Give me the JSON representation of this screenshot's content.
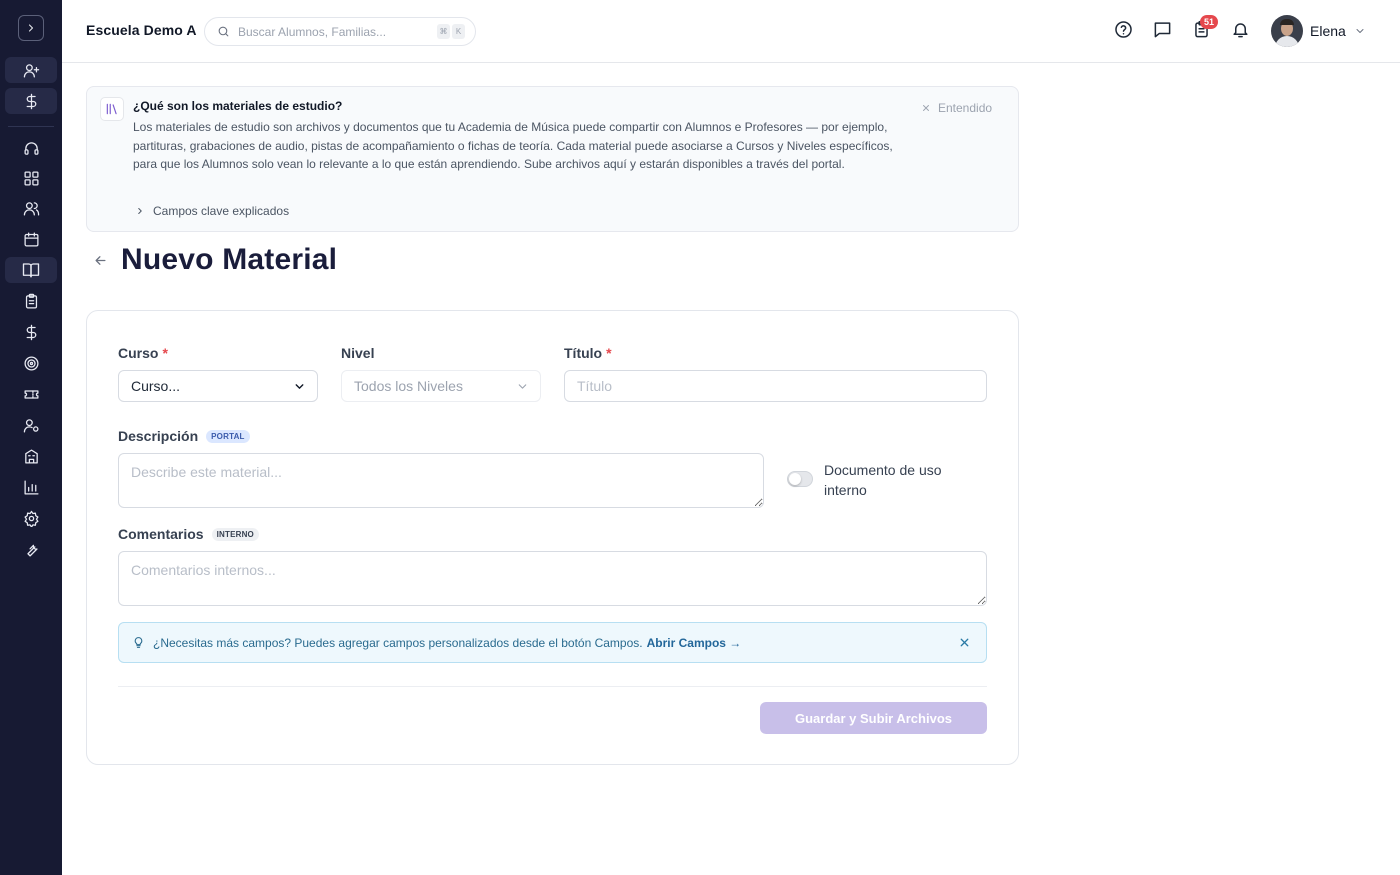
{
  "header": {
    "school_name": "Escuela Demo A",
    "search_placeholder": "Buscar Alumnos, Familias...",
    "shortcut_keys": [
      "⌘",
      "K"
    ],
    "notification_count": "51",
    "user_name": "Elena"
  },
  "sidebar": {
    "items": [
      {
        "icon": "user-plus-icon"
      },
      {
        "icon": "dollar-icon"
      },
      {
        "icon": "headset-icon"
      },
      {
        "icon": "dashboard-icon"
      },
      {
        "icon": "users-icon"
      },
      {
        "icon": "calendar-icon"
      },
      {
        "icon": "book-open-icon",
        "active": true
      },
      {
        "icon": "clipboard-icon"
      },
      {
        "icon": "dollar-icon"
      },
      {
        "icon": "target-icon"
      },
      {
        "icon": "ticket-icon"
      },
      {
        "icon": "user-cog-icon"
      },
      {
        "icon": "building-icon"
      },
      {
        "icon": "bar-chart-icon"
      },
      {
        "icon": "settings-icon"
      },
      {
        "icon": "wrench-icon"
      }
    ]
  },
  "info_banner": {
    "title": "¿Qué son los materiales de estudio?",
    "body": "Los materiales de estudio son archivos y documentos que tu Academia de Música puede compartir con Alumnos e Profesores — por ejemplo, partituras, grabaciones de audio, pistas de acompañamiento o fichas de teoría. Cada material puede asociarse a Cursos y Niveles específicos, para que los Alumnos solo vean lo relevante a lo que están aprendiendo. Sube archivos aquí y estarán disponibles a través del portal.",
    "dismiss_label": "Entendido",
    "expand_label": "Campos clave explicados"
  },
  "page": {
    "title": "Nuevo Material"
  },
  "form": {
    "course_label": "Curso",
    "course_value": "Curso...",
    "level_label": "Nivel",
    "level_value": "Todos los Niveles",
    "title_label": "Título",
    "title_placeholder": "Título",
    "required_mark": "*",
    "description_label": "Descripción",
    "description_tag": "PORTAL",
    "description_placeholder": "Describe este material...",
    "internal_toggle_label": "Documento de uso interno",
    "comments_label": "Comentarios",
    "comments_tag": "INTERNO",
    "comments_placeholder": "Comentarios internos...",
    "tip_text": "¿Necesitas más campos? Puedes agregar campos personalizados desde el botón Campos.",
    "tip_link": "Abrir Campos →",
    "submit_label": "Guardar y Subir Archivos"
  },
  "colors": {
    "sidebar_bg": "#171a33",
    "title": "#1a1d3b",
    "required": "#e5484d",
    "submit_disabled": "#c8bfe9",
    "tip_bg": "#eef8fd",
    "badge": "#e5484d"
  }
}
